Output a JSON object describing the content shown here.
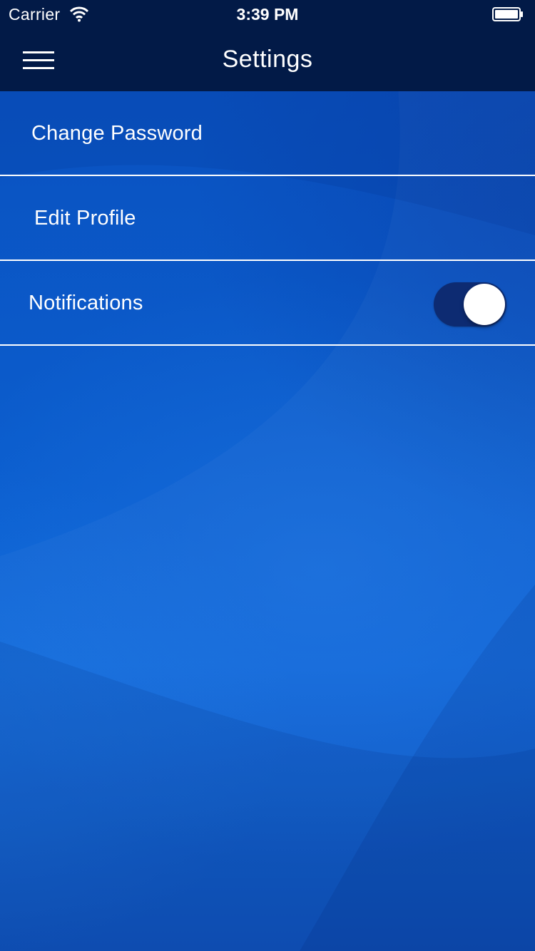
{
  "status_bar": {
    "carrier": "Carrier",
    "time": "3:39 PM",
    "wifi_icon": "wifi-icon",
    "battery_icon": "battery-icon"
  },
  "nav_bar": {
    "title": "Settings",
    "menu_icon": "hamburger-menu-icon"
  },
  "settings": {
    "items": [
      {
        "label": "Change Password"
      },
      {
        "label": "Edit Profile"
      },
      {
        "label": "Notifications",
        "toggle_on": true
      }
    ]
  },
  "colors": {
    "bar_background": "#021a47",
    "page_background": "#0b55c4",
    "divider": "#ffffff",
    "toggle_track_on": "#0d2b72",
    "toggle_knob": "#ffffff"
  }
}
